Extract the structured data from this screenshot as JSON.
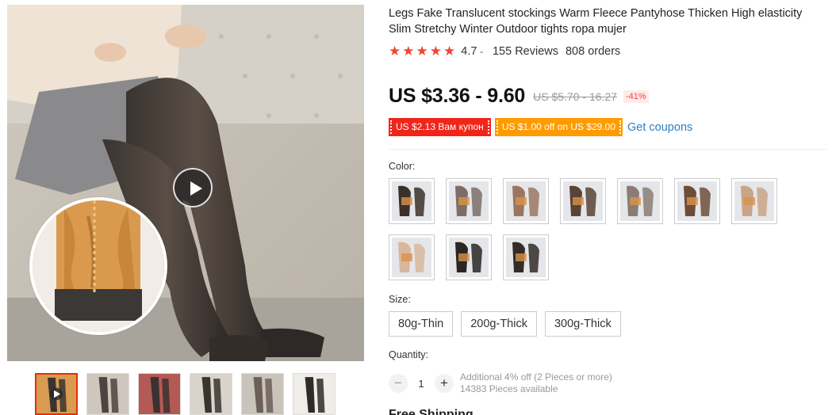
{
  "product": {
    "title": "Legs Fake Translucent stockings Warm Fleece Pantyhose Thicken High elasticity Slim Stretchy Winter Outdoor tights ropa mujer",
    "rating": "4.7",
    "rating_chevron": "⌄",
    "star_icon": "★",
    "star_count": 5,
    "reviews": "155 Reviews",
    "orders": "808 orders"
  },
  "price": {
    "current": "US $3.36 - 9.60",
    "original": "US $5.70 - 16.27",
    "discount": "-41%"
  },
  "coupons": {
    "items": [
      {
        "label": "US $2.13 Вам купон",
        "color": "#f0261a"
      },
      {
        "label": "US $1.00 off on US $29.00",
        "color": "#ff9b00"
      }
    ],
    "get_label": "Get coupons"
  },
  "color": {
    "label": "Color:",
    "swatch_count": 10
  },
  "size": {
    "label": "Size:",
    "options": [
      "80g-Thin",
      "200g-Thick",
      "300g-Thick"
    ]
  },
  "quantity": {
    "label": "Quantity:",
    "minus": "−",
    "plus": "+",
    "value": "1",
    "note_line1": "Additional 4% off (2 Pieces or more)",
    "note_line2": "14383 Pieces available"
  },
  "shipping": {
    "label": "Free Shipping"
  },
  "gallery": {
    "thumb_count": 6,
    "active_thumb": 0
  },
  "colors": {
    "accent": "#f44336",
    "link": "#2c7fc3"
  }
}
